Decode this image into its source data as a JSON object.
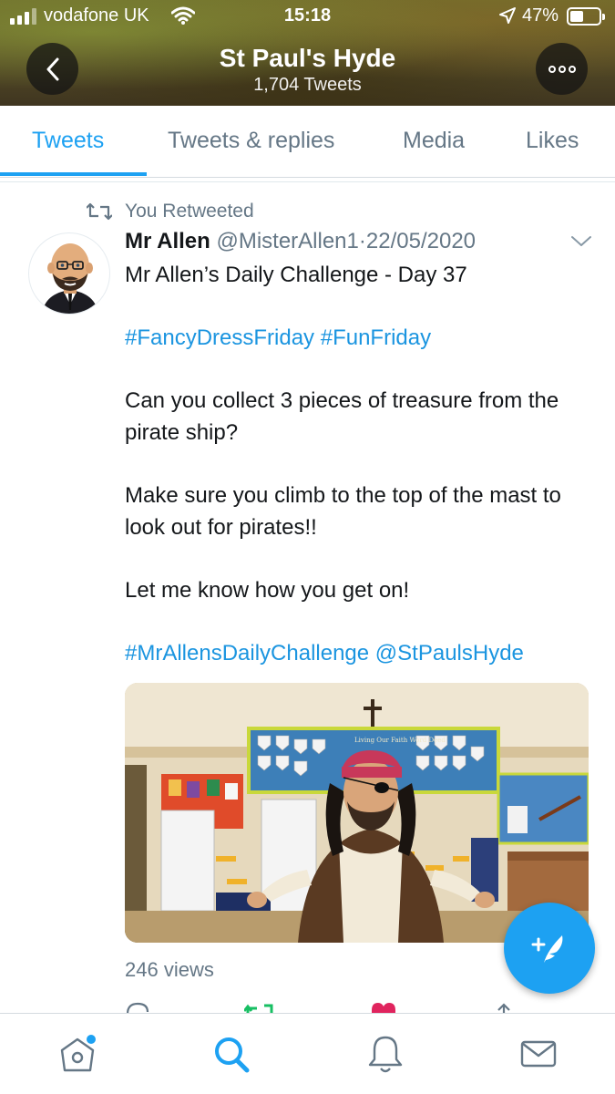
{
  "status_bar": {
    "carrier": "vodafone UK",
    "time": "15:18",
    "battery": "47%",
    "battery_level": 0.47,
    "icons": [
      "signal-icon",
      "wifi-icon",
      "location-arrow-icon",
      "battery-icon"
    ]
  },
  "header": {
    "title": "St Paul's Hyde",
    "subtitle": "1,704 Tweets",
    "back_icon": "chevron-left-icon",
    "more_icon": "more-icon"
  },
  "tabs": [
    {
      "label": "Tweets",
      "active": true
    },
    {
      "label": "Tweets & replies",
      "active": false
    },
    {
      "label": "Media",
      "active": false
    },
    {
      "label": "Likes",
      "active": false
    }
  ],
  "tweet": {
    "retweet_label": "You Retweeted",
    "author_name": "Mr Allen",
    "author_handle": "@MisterAllen1",
    "separator": "·",
    "date": "22/05/2020",
    "lines": [
      "Mr Allen’s Daily Challenge - Day 37",
      "",
      "#FancyDressFriday #FunFriday",
      "",
      "Can you collect 3 pieces of treasure from the pirate ship?",
      "",
      "Make sure you climb to the top of the mast to look out for pirates!!",
      "",
      "Let me know how you get on!",
      "",
      "#MrAllensDailyChallenge @StPaulsHyde"
    ],
    "hashtags_1": "#FancyDressFriday #FunFriday",
    "hashtags_2": "#MrAllensDailyChallenge @StPaulsHyde",
    "views": "246 views",
    "media_sign_text": "Living Our Faith Word Deed"
  },
  "colors": {
    "accent": "#1da1f2",
    "link": "#1b95e0",
    "secondary_text": "#657786",
    "like": "#e0245e",
    "retweet": "#17bf63"
  },
  "bottom_nav": [
    {
      "name": "home-icon",
      "has_notification_dot": true
    },
    {
      "name": "search-icon",
      "active": true
    },
    {
      "name": "bell-icon"
    },
    {
      "name": "mail-icon"
    }
  ]
}
